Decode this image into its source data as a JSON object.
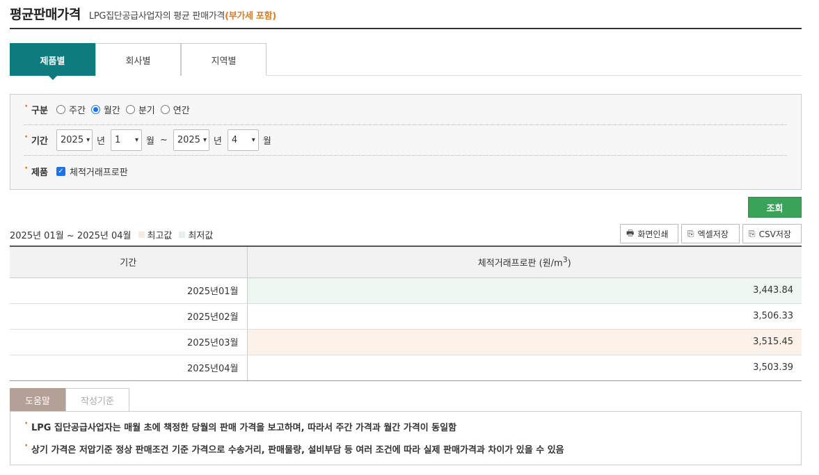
{
  "header": {
    "title": "평균판매가격",
    "subtitle_prefix": "LPG집단공급사업자의 평균 판매가격",
    "subtitle_highlight": "(부가세 포함)"
  },
  "tabs": [
    {
      "label": "제품별",
      "active": true
    },
    {
      "label": "회사별",
      "active": false
    },
    {
      "label": "지역별",
      "active": false
    }
  ],
  "filter": {
    "type_label": "구분",
    "type_options": [
      {
        "label": "주간",
        "selected": false
      },
      {
        "label": "월간",
        "selected": true
      },
      {
        "label": "분기",
        "selected": false
      },
      {
        "label": "연간",
        "selected": false
      }
    ],
    "period_label": "기간",
    "from_year": "2025",
    "from_month": "1",
    "to_year": "2025",
    "to_month": "4",
    "year_unit": "년",
    "month_unit": "월",
    "tilde": "~",
    "product_label": "제품",
    "product_option": "체적거래프로판",
    "product_checked": true
  },
  "search_button": "조회",
  "info": {
    "range_text": "2025년 01월 ~ 2025년 04월",
    "legend_max": "최고값",
    "legend_min": "최저값",
    "max_color": "#fbe9dc",
    "min_color": "#e3f1ea"
  },
  "toolbar": {
    "print": "화면인쇄",
    "excel": "엑셀저장",
    "csv": "CSV저장"
  },
  "table": {
    "col_period": "기간",
    "col_product": "체적거래프로판 (원/m",
    "col_product_sup": "3",
    "col_product_end": ")",
    "rows": [
      {
        "period": "2025년01월",
        "value": "3,443.84",
        "mark": "min"
      },
      {
        "period": "2025년02월",
        "value": "3,506.33",
        "mark": ""
      },
      {
        "period": "2025년03월",
        "value": "3,515.45",
        "mark": "max"
      },
      {
        "period": "2025년04월",
        "value": "3,503.39",
        "mark": ""
      }
    ]
  },
  "help": {
    "tabs": [
      "도움말",
      "작성기준"
    ],
    "lines": [
      "LPG 집단공급사업자는 매월 초에 책정한 당월의 판매 가격을 보고하며, 따라서 주간 가격과 월간 가격이 동일함",
      "상기 가격은 저압기준 정상 판매조건 기준 가격으로 수송거리, 판매물량, 설비부담 등 여러 조건에 따라 실제 판매가격과 차이가 있을 수 있음"
    ]
  },
  "colors": {
    "accent": "#0e7b7e",
    "search_button": "#3aa35a",
    "highlight_text": "#e07b1f",
    "help_tab": "#b5a097"
  }
}
